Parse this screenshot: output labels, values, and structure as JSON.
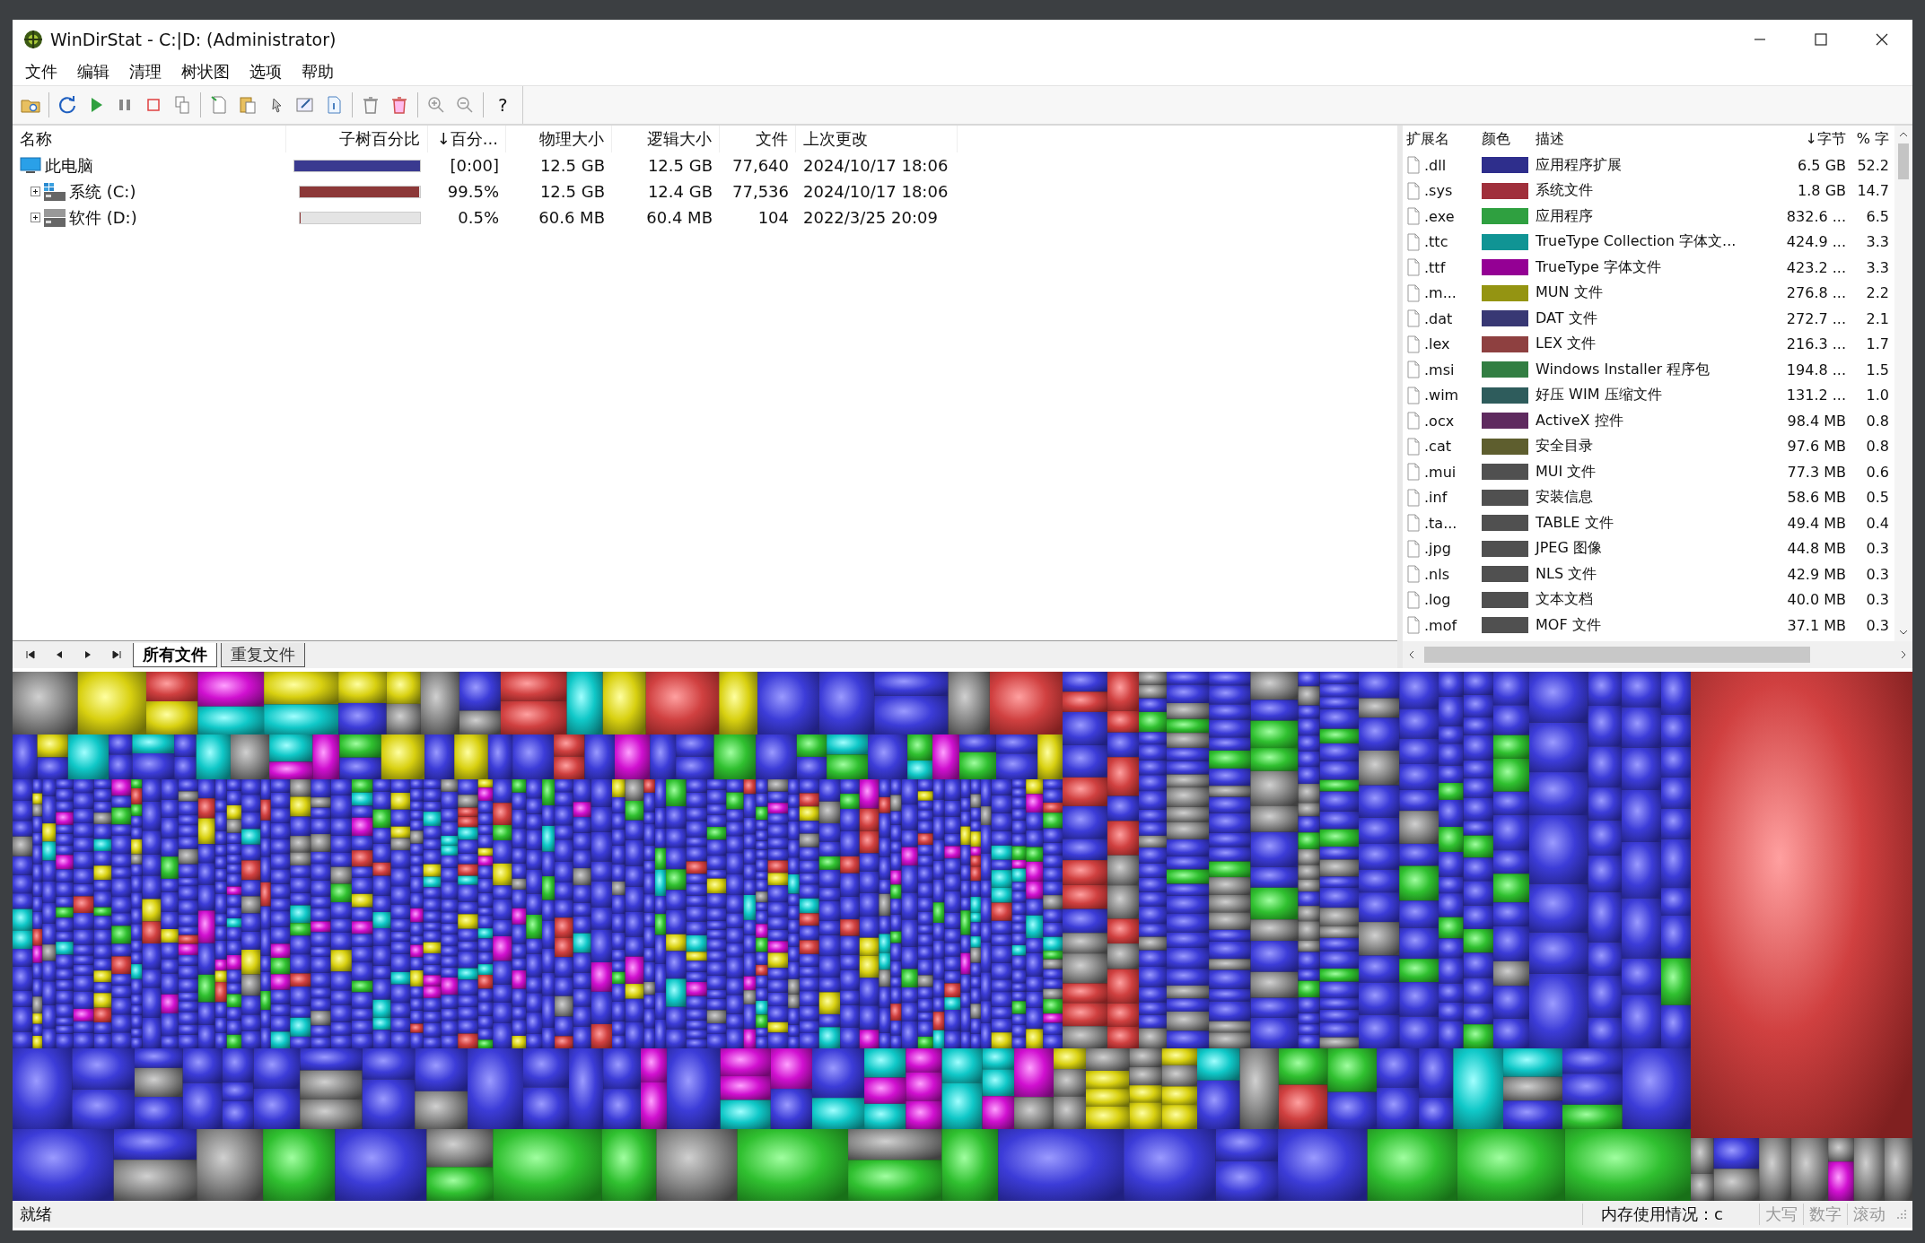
{
  "window": {
    "title": "WinDirStat - C:|D:  (Administrator)"
  },
  "menu": [
    "文件",
    "编辑",
    "清理",
    "树状图",
    "选项",
    "帮助"
  ],
  "toolbar": {
    "help": "?"
  },
  "tree": {
    "columns": [
      "名称",
      "子树百分比",
      "↓百分...",
      "物理大小",
      "逻辑大小",
      "文件",
      "上次更改"
    ],
    "root": {
      "name": "此电脑",
      "level": 1.0,
      "color": "#3a3a90",
      "percent": "[0:00]",
      "physical": "12.5 GB",
      "logical": "12.5 GB",
      "files": "77,640",
      "modified": "2024/10/17  18:06",
      "children": [
        {
          "name": "系统 (C:)",
          "expanded": false,
          "level": 0.995,
          "color": "#8c3838",
          "percent": "99.5%",
          "physical": "12.5 GB",
          "logical": "12.4 GB",
          "files": "77,536",
          "modified": "2024/10/17  18:06"
        },
        {
          "name": "软件 (D:)",
          "expanded": false,
          "level": 0.005,
          "color": "#8c3838",
          "percent": "0.5%",
          "physical": "60.6 MB",
          "logical": "60.4 MB",
          "files": "104",
          "modified": "2022/3/25  20:09"
        }
      ]
    }
  },
  "tabs": [
    {
      "label": "所有文件",
      "selected": true
    },
    {
      "label": "重复文件",
      "selected": false
    }
  ],
  "extensions": {
    "columns": [
      "扩展名",
      "颜色",
      "描述",
      "↓字节",
      "% 字"
    ],
    "rows": [
      {
        "ext": ".dll",
        "color": "#2e2e8c",
        "description": "应用程序扩展",
        "bytes": "6.5 GB",
        "percent": "52.2"
      },
      {
        "ext": ".sys",
        "color": "#a0303c",
        "description": "系统文件",
        "bytes": "1.8 GB",
        "percent": "14.7"
      },
      {
        "ext": ".exe",
        "color": "#2fa040",
        "description": "应用程序",
        "bytes": "832.6 ...",
        "percent": "6.5"
      },
      {
        "ext": ".ttc",
        "color": "#109494",
        "description": "TrueType Collection 字体文...",
        "bytes": "424.9 ...",
        "percent": "3.3"
      },
      {
        "ext": ".ttf",
        "color": "#940094",
        "description": "TrueType 字体文件",
        "bytes": "423.2 ...",
        "percent": "3.3"
      },
      {
        "ext": ".m...",
        "color": "#949412",
        "description": "MUN 文件",
        "bytes": "276.8 ...",
        "percent": "2.2"
      },
      {
        "ext": ".dat",
        "color": "#383874",
        "description": "DAT 文件",
        "bytes": "272.7 ...",
        "percent": "2.1"
      },
      {
        "ext": ".lex",
        "color": "#8e4040",
        "description": "LEX 文件",
        "bytes": "216.3 ...",
        "percent": "1.7"
      },
      {
        "ext": ".msi",
        "color": "#327e42",
        "description": "Windows Installer 程序包",
        "bytes": "194.8 ...",
        "percent": "1.5"
      },
      {
        "ext": ".wim",
        "color": "#2e5c5c",
        "description": "好压 WIM 压缩文件",
        "bytes": "131.2 ...",
        "percent": "1.0"
      },
      {
        "ext": ".ocx",
        "color": "#5e2a5e",
        "description": "ActiveX 控件",
        "bytes": "98.4 MB",
        "percent": "0.8"
      },
      {
        "ext": ".cat",
        "color": "#5e5e2e",
        "description": "安全目录",
        "bytes": "97.6 MB",
        "percent": "0.8"
      },
      {
        "ext": ".mui",
        "color": "#505050",
        "description": "MUI 文件",
        "bytes": "77.3 MB",
        "percent": "0.6"
      },
      {
        "ext": ".inf",
        "color": "#505050",
        "description": "安装信息",
        "bytes": "58.6 MB",
        "percent": "0.5"
      },
      {
        "ext": ".ta...",
        "color": "#505050",
        "description": "TABLE 文件",
        "bytes": "49.4 MB",
        "percent": "0.4"
      },
      {
        "ext": ".jpg",
        "color": "#505050",
        "description": "JPEG 图像",
        "bytes": "44.8 MB",
        "percent": "0.3"
      },
      {
        "ext": ".nls",
        "color": "#505050",
        "description": "NLS 文件",
        "bytes": "42.9 MB",
        "percent": "0.3"
      },
      {
        "ext": ".log",
        "color": "#505050",
        "description": "文本文档",
        "bytes": "40.0 MB",
        "percent": "0.3"
      },
      {
        "ext": ".mof",
        "color": "#505050",
        "description": "MOF 文件",
        "bytes": "37.1 MB",
        "percent": "0.3"
      }
    ]
  },
  "status_bar": {
    "text": "就绪",
    "memory": "内存使用情况：c",
    "indicators": [
      {
        "label": "大写",
        "active": false
      },
      {
        "label": "数字",
        "active": false
      },
      {
        "label": "滚动",
        "active": false
      }
    ]
  }
}
